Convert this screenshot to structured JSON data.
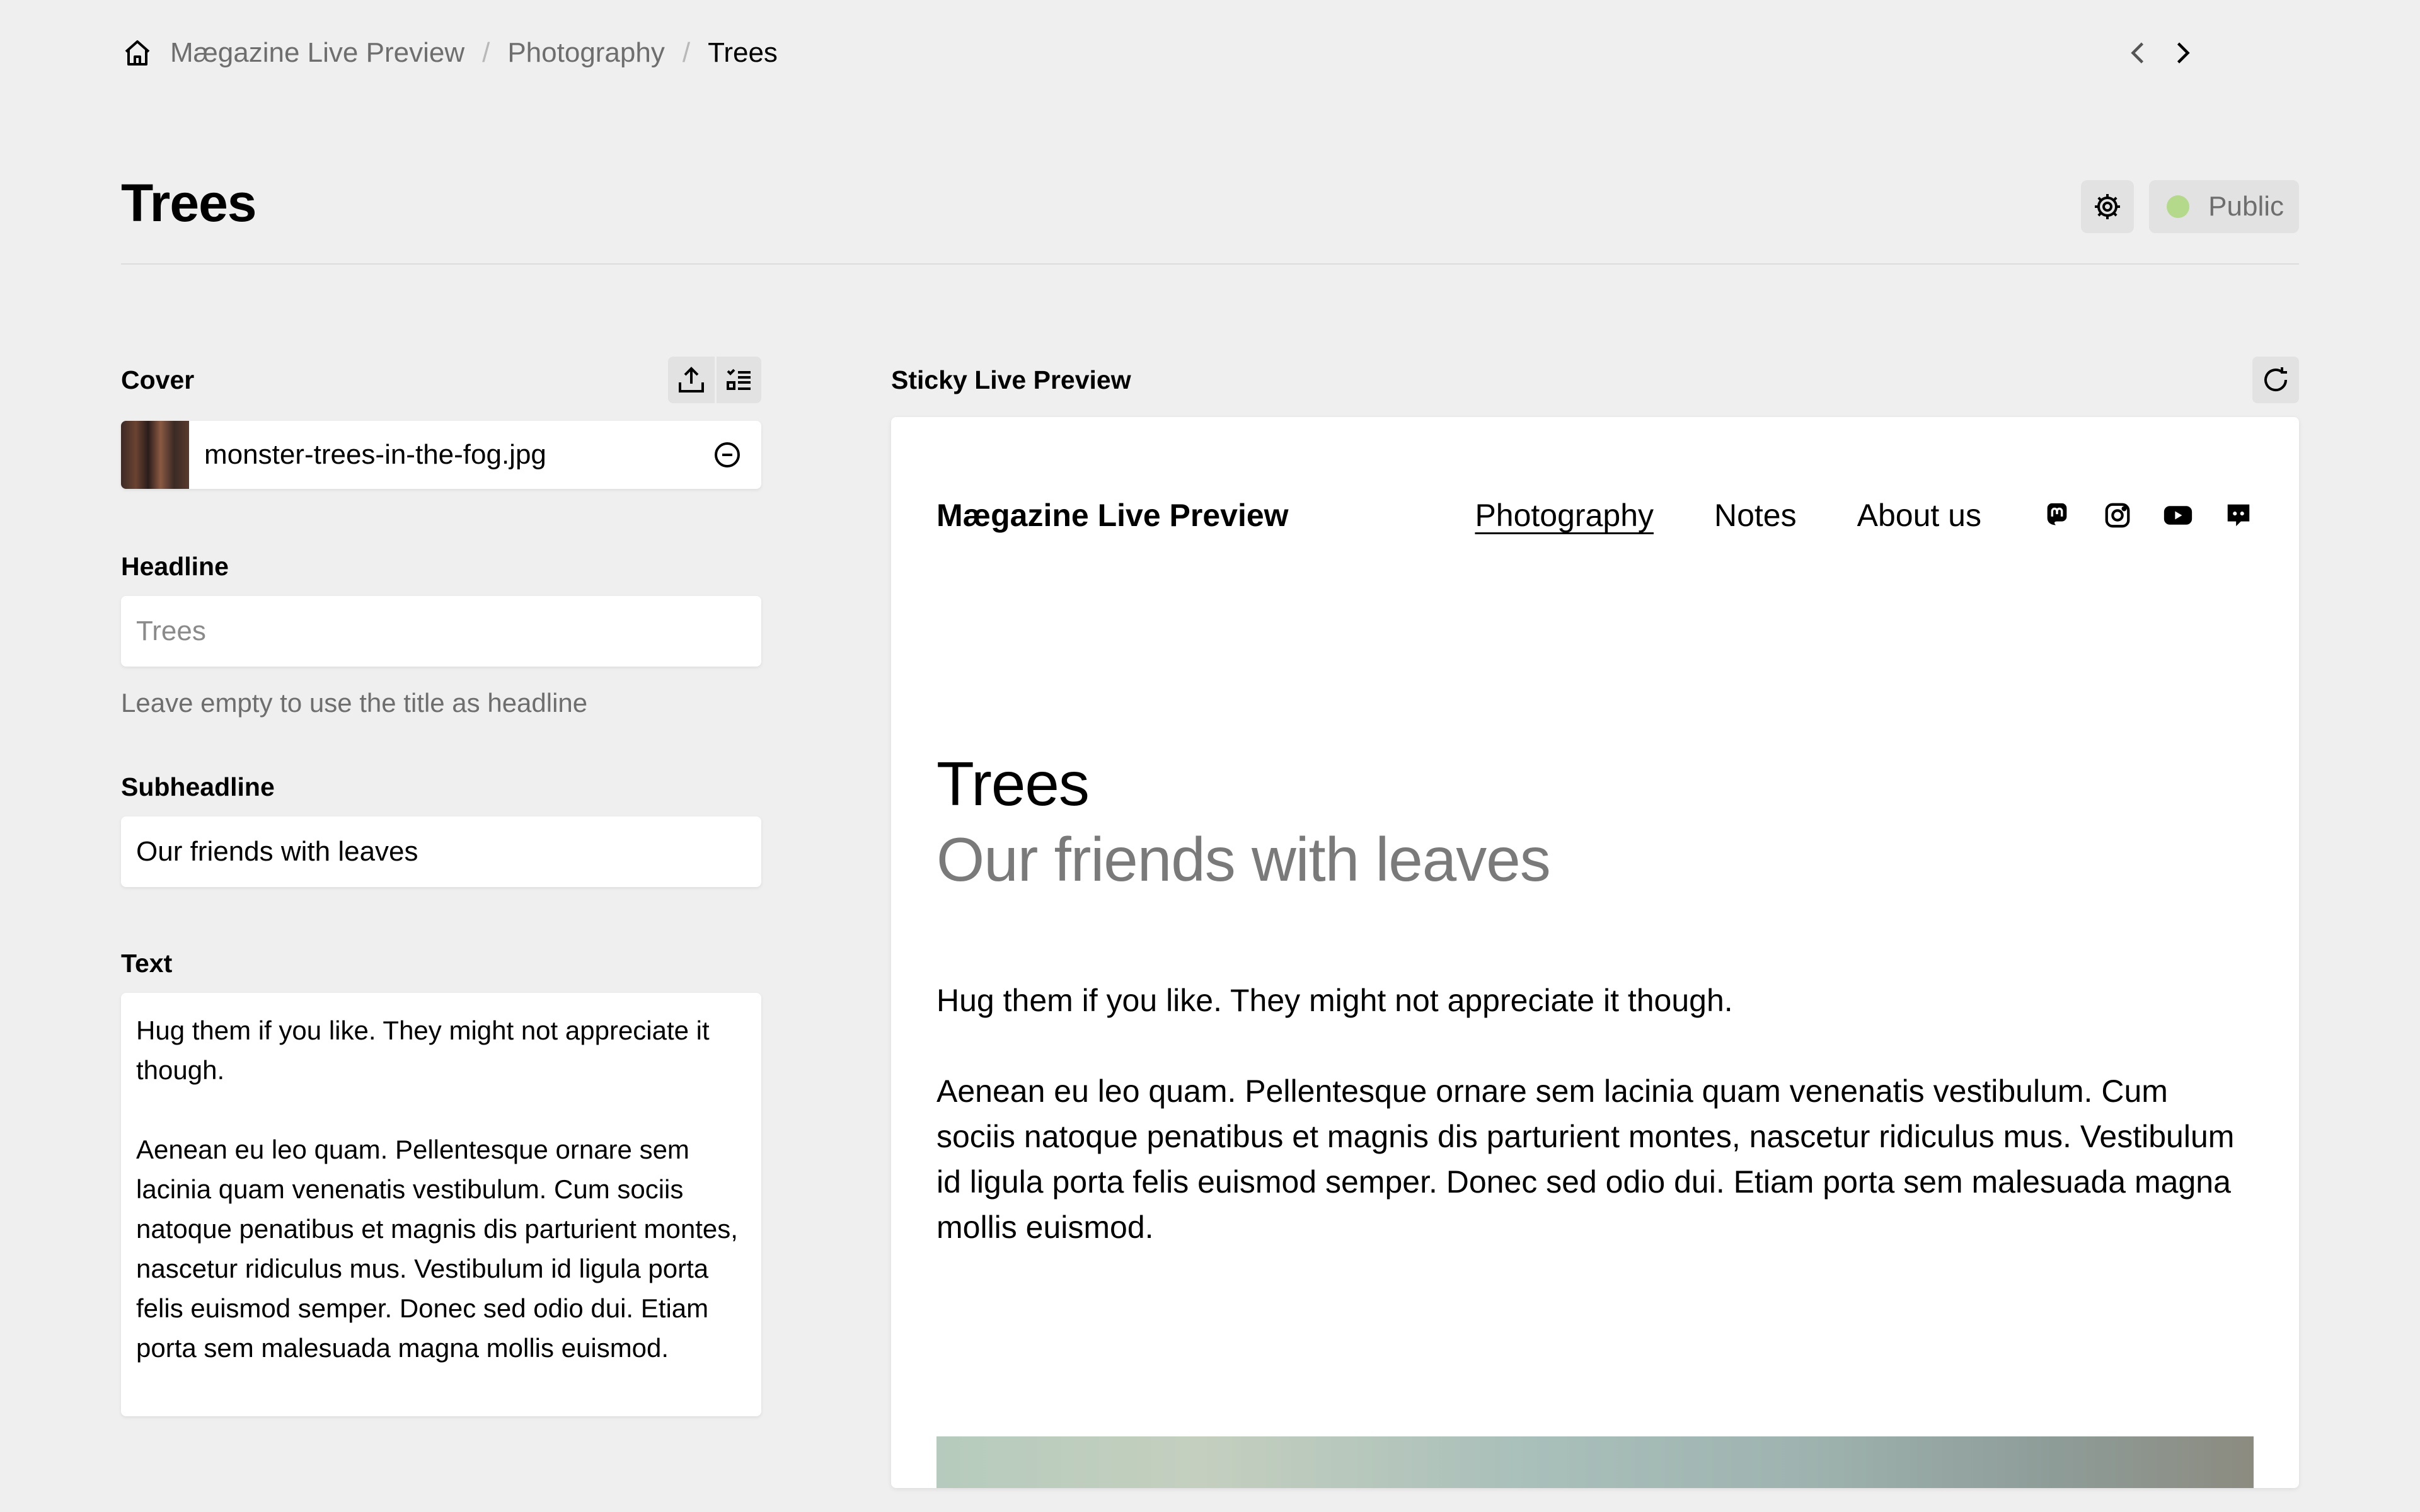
{
  "breadcrumb": {
    "home_icon": "home-icon",
    "items": [
      "Mægazine Live Preview",
      "Photography",
      "Trees"
    ],
    "separator": "/",
    "prev_icon": "chevron-left-icon",
    "next_icon": "chevron-right-icon"
  },
  "header": {
    "title": "Trees",
    "settings_icon": "gear-icon",
    "status_label": "Public",
    "status_color": "#b4d98a"
  },
  "form": {
    "cover": {
      "label": "Cover",
      "upload_icon": "upload-icon",
      "select_icon": "checklist-icon",
      "filename": "monster-trees-in-the-fog.jpg",
      "remove_icon": "minus-circle-icon"
    },
    "headline": {
      "label": "Headline",
      "placeholder": "Trees",
      "value": "",
      "help": "Leave empty to use the title as headline"
    },
    "subheadline": {
      "label": "Subheadline",
      "value": "Our friends with leaves"
    },
    "text": {
      "label": "Text",
      "value": "Hug them if you like. They might not appreciate it though.\n\nAenean eu leo quam. Pellentesque ornare sem lacinia quam venenatis vestibulum. Cum sociis natoque penatibus et magnis dis parturient montes, nascetur ridiculus mus. Vestibulum id ligula porta felis euismod semper. Donec sed odio dui. Etiam porta sem malesuada magna mollis euismod."
    }
  },
  "preview": {
    "label": "Sticky Live Preview",
    "reload_icon": "refresh-icon",
    "site_name": "Mægazine Live Preview",
    "menu": [
      "Photography",
      "Notes",
      "About us"
    ],
    "active_menu": "Photography",
    "social_icons": [
      "mastodon-icon",
      "instagram-icon",
      "youtube-icon",
      "discord-icon"
    ],
    "headline": "Trees",
    "subheadline": "Our friends with leaves",
    "paragraphs": [
      "Hug them if you like. They might not appreciate it though.",
      "Aenean eu leo quam. Pellentesque ornare sem lacinia quam venenatis vestibulum. Cum sociis natoque penatibus et magnis dis parturient montes, nascetur ridiculus mus. Vestibulum id ligula porta felis euismod semper. Donec sed odio dui. Etiam porta sem malesuada magna mollis euismod."
    ]
  }
}
